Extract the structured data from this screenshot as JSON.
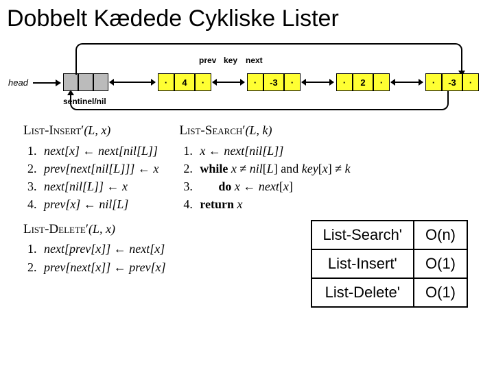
{
  "title": "Dobbelt Kædede Cykliske Lister",
  "diagram": {
    "head_label": "head",
    "sentinel_label": "sentinel/nil",
    "ptr_labels": {
      "prev": "prev",
      "key": "key",
      "next": "next"
    },
    "nodes": [
      "4",
      "-3",
      "2",
      "-3"
    ]
  },
  "algorithms": {
    "insert": {
      "name": "List-Insert′",
      "params": "(L, x)",
      "lines": [
        "next[x] ← next[nil[L]]",
        "prev[next[nil[L]]] ← x",
        "next[nil[L]] ← x",
        "prev[x] ← nil[L]"
      ]
    },
    "search": {
      "name": "List-Search′",
      "params": "(L, k)",
      "lines": [
        "x ← next[nil[L]]",
        "while x ≠ nil[L] and key[x] ≠ k",
        "       do x ← next[x]",
        "return x"
      ]
    },
    "delete": {
      "name": "List-Delete′",
      "params": "(L, x)",
      "lines": [
        "next[prev[x]] ← next[x]",
        "prev[next[x]] ← prev[x]"
      ]
    }
  },
  "complexity": {
    "rows": [
      {
        "op": "List-Search'",
        "time": "O(n)"
      },
      {
        "op": "List-Insert'",
        "time": "O(1)"
      },
      {
        "op": "List-Delete'",
        "time": "O(1)"
      }
    ]
  }
}
